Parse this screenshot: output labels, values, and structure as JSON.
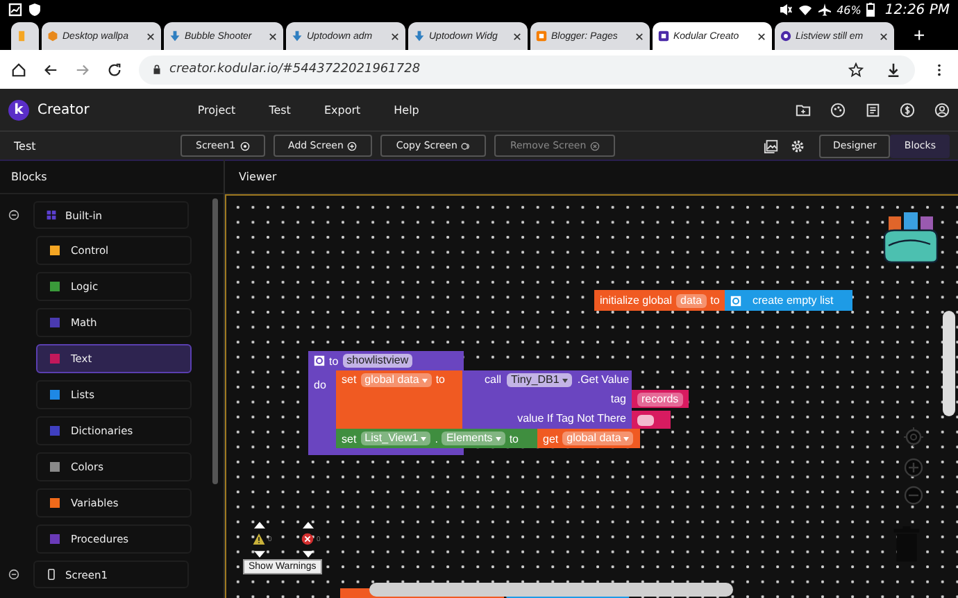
{
  "status_bar": {
    "battery": "46%",
    "time": "12:26 PM"
  },
  "tabs": [
    {
      "kind": "stub",
      "selected": false
    },
    {
      "title": "Desktop wallpa",
      "kind": "hex",
      "selected": false
    },
    {
      "title": "Bubble Shooter",
      "kind": "arrow",
      "selected": false
    },
    {
      "title": "Uptodown adm",
      "kind": "arrow",
      "selected": false
    },
    {
      "title": "Uptodown Widg",
      "kind": "arrow",
      "selected": false
    },
    {
      "title": "Blogger: Pages",
      "kind": "blogger",
      "selected": false
    },
    {
      "title": "Kodular Creato",
      "kind": "square",
      "selected": true
    },
    {
      "title": "Listview still em",
      "kind": "circle",
      "selected": false
    }
  ],
  "new_tab": "+",
  "address": "creator.kodular.io/#5443722021961728",
  "app_bar": {
    "logo": "k",
    "title": "Creator",
    "menu": [
      "Project",
      "Test",
      "Export",
      "Help"
    ]
  },
  "toolbar": {
    "project": "Test",
    "buttons": [
      {
        "label": "Screen1",
        "disabled": false
      },
      {
        "label": "Add Screen",
        "disabled": false
      },
      {
        "label": "Copy Screen",
        "disabled": false
      },
      {
        "label": "Remove Screen",
        "disabled": true
      }
    ],
    "modes": [
      {
        "label": "Designer",
        "selected": false
      },
      {
        "label": "Blocks",
        "selected": true
      }
    ]
  },
  "sidebar": {
    "title": "Blocks",
    "tree": [
      {
        "label": "Built-in",
        "expanded": true,
        "children": [
          {
            "label": "Control",
            "color": "#f5a623",
            "selected": false
          },
          {
            "label": "Logic",
            "color": "#3a9a3a",
            "selected": false
          },
          {
            "label": "Math",
            "color": "#4a3ab0",
            "selected": false
          },
          {
            "label": "Text",
            "color": "#c2185b",
            "selected": true
          },
          {
            "label": "Lists",
            "color": "#1e88e5",
            "selected": false
          },
          {
            "label": "Dictionaries",
            "color": "#3f3fc0",
            "selected": false
          },
          {
            "label": "Colors",
            "color": "#8a8a8a",
            "selected": false
          },
          {
            "label": "Variables",
            "color": "#f06a1a",
            "selected": false
          },
          {
            "label": "Procedures",
            "color": "#6a3ab8",
            "selected": false
          }
        ]
      },
      {
        "label": "Screen1",
        "expanded": true
      }
    ]
  },
  "viewer": {
    "title": "Viewer",
    "global_init": {
      "label": "initialize global",
      "name": "data",
      "to": "to",
      "value": "create empty list"
    },
    "procedure": {
      "to": "to",
      "name": "showlistview",
      "do": "do",
      "set_var": {
        "set": "set",
        "var": "global data",
        "to": "to"
      },
      "call": {
        "call": "call",
        "component": "Tiny_DB1",
        "method": ".Get Value"
      },
      "args": [
        {
          "label": "tag",
          "kind": "text",
          "value": "records"
        },
        {
          "label": "value If Tag Not There",
          "kind": "empty"
        }
      ],
      "set_prop": {
        "set": "set",
        "component": "List_View1",
        "dot": ".",
        "property": "Elements",
        "to": "to",
        "get": "get",
        "var": "global data"
      }
    },
    "warnings": {
      "warning_count": "0",
      "error_count": "0",
      "button": "Show Warnings"
    }
  }
}
